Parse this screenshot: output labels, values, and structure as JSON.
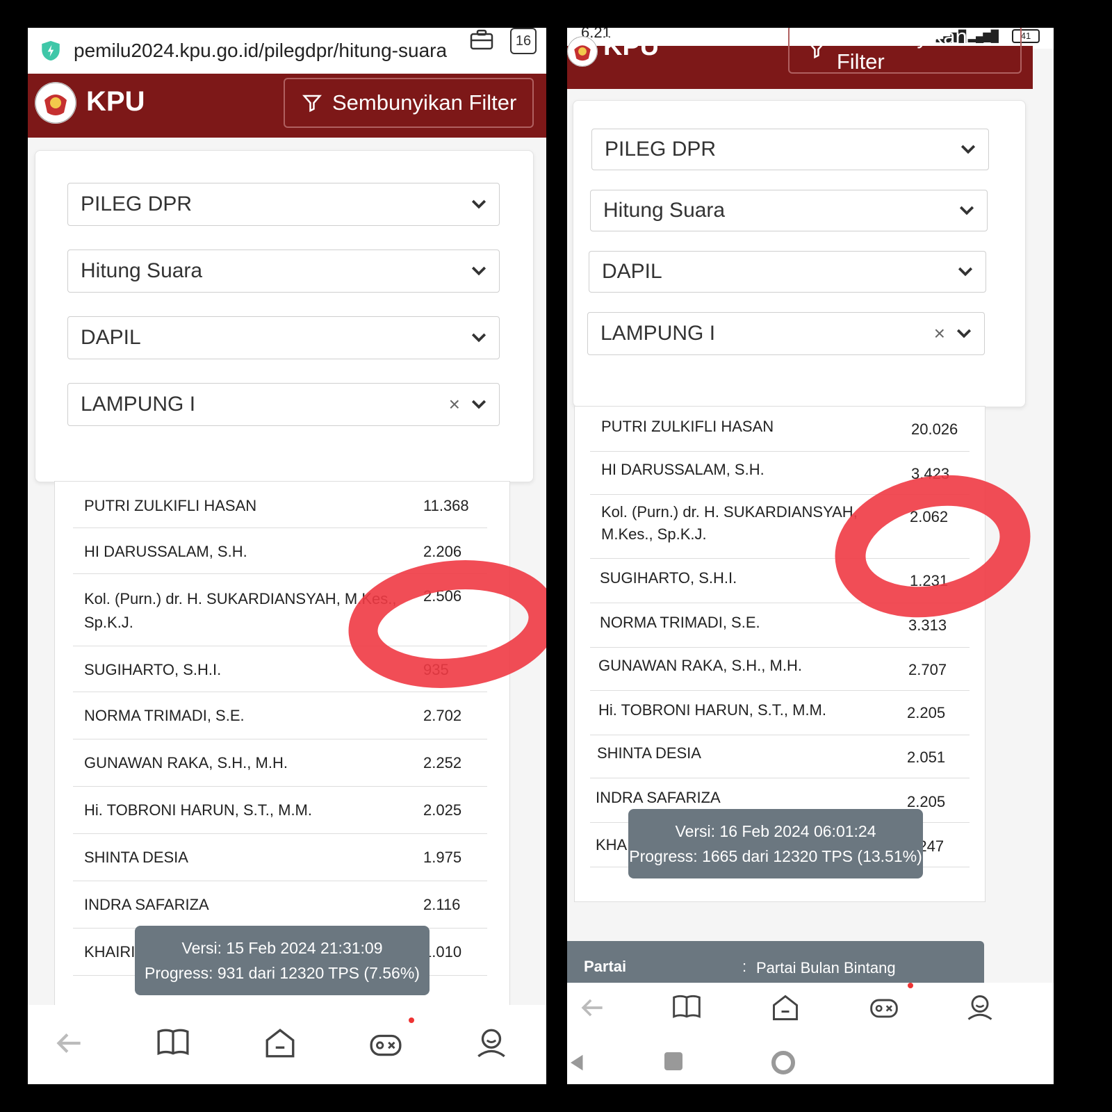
{
  "colors": {
    "header": "#7d1818",
    "toast": "#6b7780",
    "circle": "#f03a44"
  },
  "left": {
    "url": "pemilu2024.kpu.go.id/pilegdpr/hitung-suara",
    "tab_count": "16",
    "brand": "KPU",
    "filter_label": "Sembunyikan Filter",
    "selects": [
      "PILEG DPR",
      "Hitung Suara",
      "DAPIL",
      "LAMPUNG I"
    ],
    "clear_icon": "×",
    "candidates": [
      {
        "name": "PUTRI ZULKIFLI HASAN",
        "votes": "11.368"
      },
      {
        "name": "HI DARUSSALAM, S.H.",
        "votes": "2.206"
      },
      {
        "name": "Kol. (Purn.) dr. H. SUKARDIANSYAH, M.Kes., Sp.K.J.",
        "votes": "2.506"
      },
      {
        "name": "SUGIHARTO, S.H.I.",
        "votes": "935"
      },
      {
        "name": "NORMA TRIMADI, S.E.",
        "votes": "2.702"
      },
      {
        "name": "GUNAWAN RAKA, S.H., M.H.",
        "votes": "2.252"
      },
      {
        "name": "Hi. TOBRONI HARUN, S.T., M.M.",
        "votes": "2.025"
      },
      {
        "name": "SHINTA DESIA",
        "votes": "1.975"
      },
      {
        "name": "INDRA SAFARIZA",
        "votes": "2.116"
      },
      {
        "name": "KHAIRI",
        "votes": "1.010"
      }
    ],
    "toast": {
      "version": "Versi: 15 Feb 2024 21:31:09",
      "progress": "Progress: 931 dari 12320 TPS (7.56%)"
    }
  },
  "right": {
    "status_time": "6.21",
    "battery": "41",
    "brand": "KPU",
    "filter_label": "Sembunyikan Filter",
    "selects": [
      "PILEG DPR",
      "Hitung Suara",
      "DAPIL",
      "LAMPUNG I"
    ],
    "clear_icon": "×",
    "candidates": [
      {
        "name": "PUTRI ZULKIFLI HASAN",
        "votes": "20.026"
      },
      {
        "name": "HI DARUSSALAM, S.H.",
        "votes": "3.423"
      },
      {
        "name": "Kol. (Purn.) dr. H. SUKARDIANSYAH, M.Kes., Sp.K.J.",
        "votes": "2.062"
      },
      {
        "name": "SUGIHARTO, S.H.I.",
        "votes": "1.231"
      },
      {
        "name": "NORMA TRIMADI, S.E.",
        "votes": "3.313"
      },
      {
        "name": "GUNAWAN RAKA, S.H., M.H.",
        "votes": "2.707"
      },
      {
        "name": "Hi. TOBRONI HARUN, S.T., M.M.",
        "votes": "2.205"
      },
      {
        "name": "SHINTA DESIA",
        "votes": "2.051"
      },
      {
        "name": "INDRA SAFARIZA",
        "votes": "2.205"
      },
      {
        "name": "KHAIRI",
        "votes": "1.247"
      }
    ],
    "toast": {
      "version": "Versi: 16 Feb 2024 06:01:24",
      "progress": "Progress: 1665 dari 12320 TPS (13.51%)"
    },
    "partai": {
      "label": "Partai",
      "colon": ":",
      "value": "Partai Bulan Bintang"
    }
  }
}
